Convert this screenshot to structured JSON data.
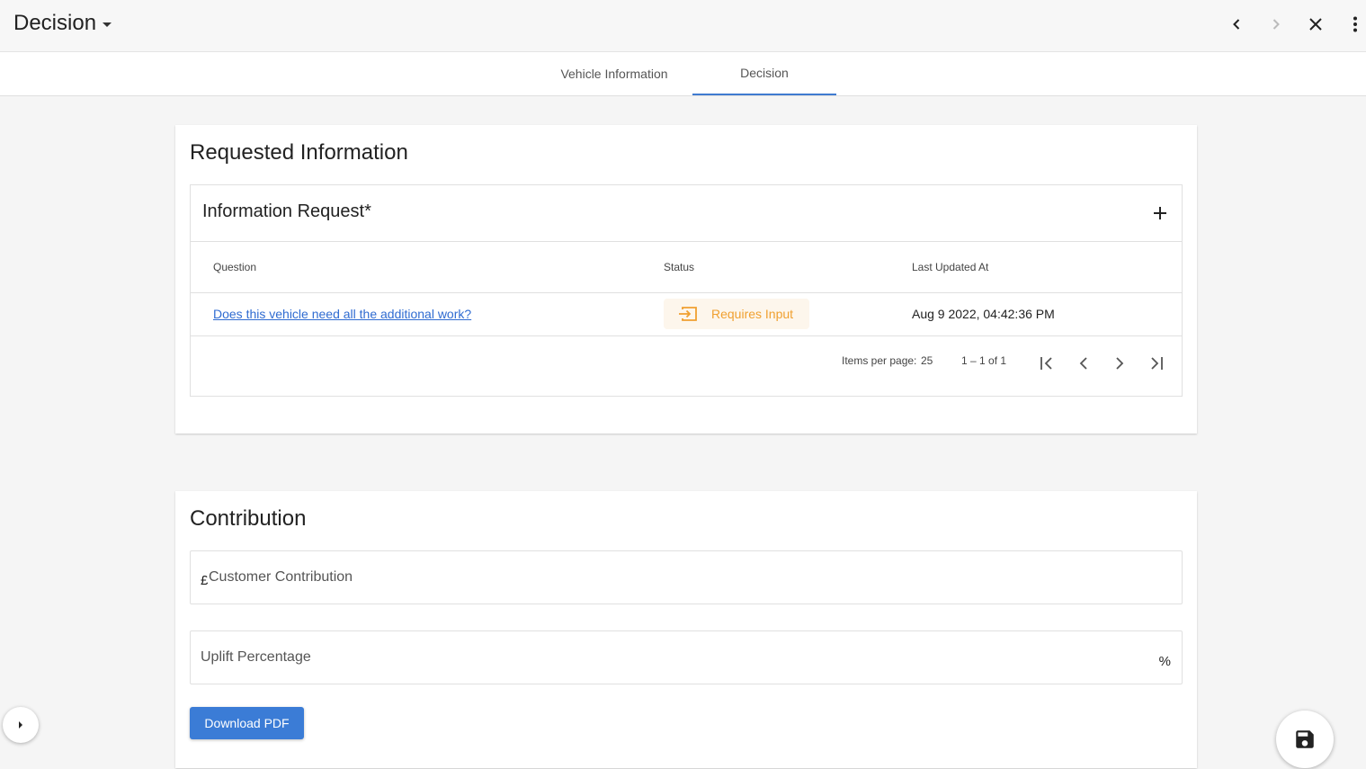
{
  "header": {
    "title": "Decision",
    "icons": [
      "chevron-left-icon",
      "chevron-right-icon",
      "close-icon",
      "more-vert-icon"
    ]
  },
  "tabs": [
    {
      "label": "Vehicle Information",
      "active": false
    },
    {
      "label": "Decision",
      "active": true
    }
  ],
  "requested_information": {
    "title": "Requested Information",
    "panel_title": "Information Request*",
    "columns": [
      "Question",
      "Status",
      "Last Updated At"
    ],
    "rows": [
      {
        "question": "Does this vehicle need all the additional work?",
        "status": "Requires Input",
        "last_updated": "Aug 9 2022, 04:42:36 PM"
      }
    ],
    "pagination": {
      "items_per_page_label": "Items per page:",
      "items_per_page": "25",
      "range": "1 – 1 of 1"
    }
  },
  "contribution": {
    "title": "Contribution",
    "customer_contribution": {
      "prefix": "£",
      "label": "Customer Contribution",
      "value": ""
    },
    "uplift_percentage": {
      "label": "Uplift Percentage",
      "suffix": "%",
      "value": ""
    },
    "download_label": "Download PDF"
  },
  "colors": {
    "accent": "#3b7cd6",
    "link": "#2f6bd1",
    "status_warning": "#f0a030",
    "status_bg": "#fdf6ec"
  }
}
